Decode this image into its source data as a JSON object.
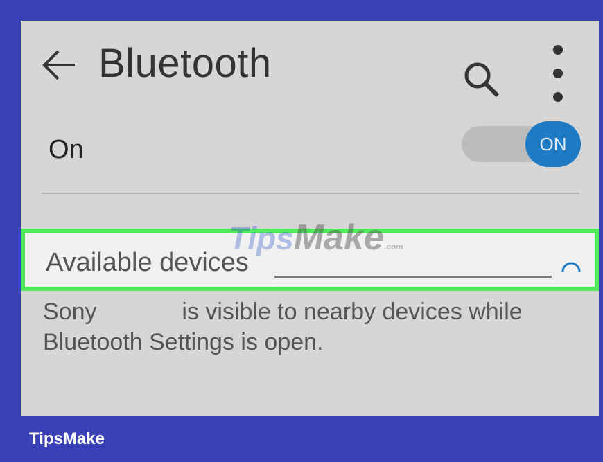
{
  "appbar": {
    "title": "Bluetooth"
  },
  "bluetooth_toggle": {
    "label": "On",
    "switch_text": "ON",
    "state": "on",
    "accent_color": "#1e7bc4"
  },
  "available": {
    "label": "Available devices",
    "highlight_color": "#4ee85a"
  },
  "description": {
    "line1_start": "Sony",
    "line1_end": "is visible to nearby devices while",
    "line2": "Bluetooth Settings is open."
  },
  "watermark": {
    "tips": "Tips",
    "make": "Make",
    "com": ".com"
  },
  "footer": {
    "brand": "TipsMake",
    "background_color": "#3a40b8"
  }
}
